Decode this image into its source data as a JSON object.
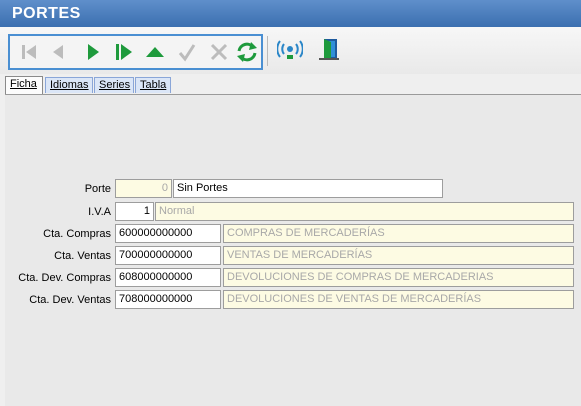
{
  "window": {
    "title": "PORTES"
  },
  "toolbar": {
    "buttons": [
      {
        "name": "first-record-icon"
      },
      {
        "name": "previous-record-icon"
      },
      {
        "name": "next-record-icon"
      },
      {
        "name": "last-record-icon"
      },
      {
        "name": "insert-up-icon"
      },
      {
        "name": "accept-check-icon"
      },
      {
        "name": "cancel-x-icon"
      },
      {
        "name": "refresh-icon"
      },
      {
        "name": "broadcast-icon"
      },
      {
        "name": "exit-door-icon"
      }
    ]
  },
  "tabs": [
    {
      "label": "Ficha",
      "active": true
    },
    {
      "label": "Idiomas"
    },
    {
      "label": "Series"
    },
    {
      "label": "Tabla"
    }
  ],
  "form": {
    "porte": {
      "label": "Porte",
      "code": "0",
      "name": "Sin Portes"
    },
    "iva": {
      "label": "I.V.A",
      "code": "1",
      "name": "Normal"
    },
    "cta_compras": {
      "label": "Cta. Compras",
      "account": "600000000000",
      "description": "COMPRAS DE MERCADERÍAS"
    },
    "cta_ventas": {
      "label": "Cta. Ventas",
      "account": "700000000000",
      "description": "VENTAS DE MERCADERÍAS"
    },
    "cta_dev_compras": {
      "label": "Cta. Dev. Compras",
      "account": "608000000000",
      "description": "DEVOLUCIONES DE COMPRAS DE MERCADERIAS"
    },
    "cta_dev_ventas": {
      "label": "Cta. Dev. Ventas",
      "account": "708000000000",
      "description": "DEVOLUCIONES DE VENTAS DE MERCADERÍAS"
    }
  },
  "colors": {
    "title_bar": "#3b6fb0",
    "nav_green": "#1e9a3c",
    "disabled_gray": "#b8b8b8",
    "field_cream": "#fdfbe3"
  }
}
